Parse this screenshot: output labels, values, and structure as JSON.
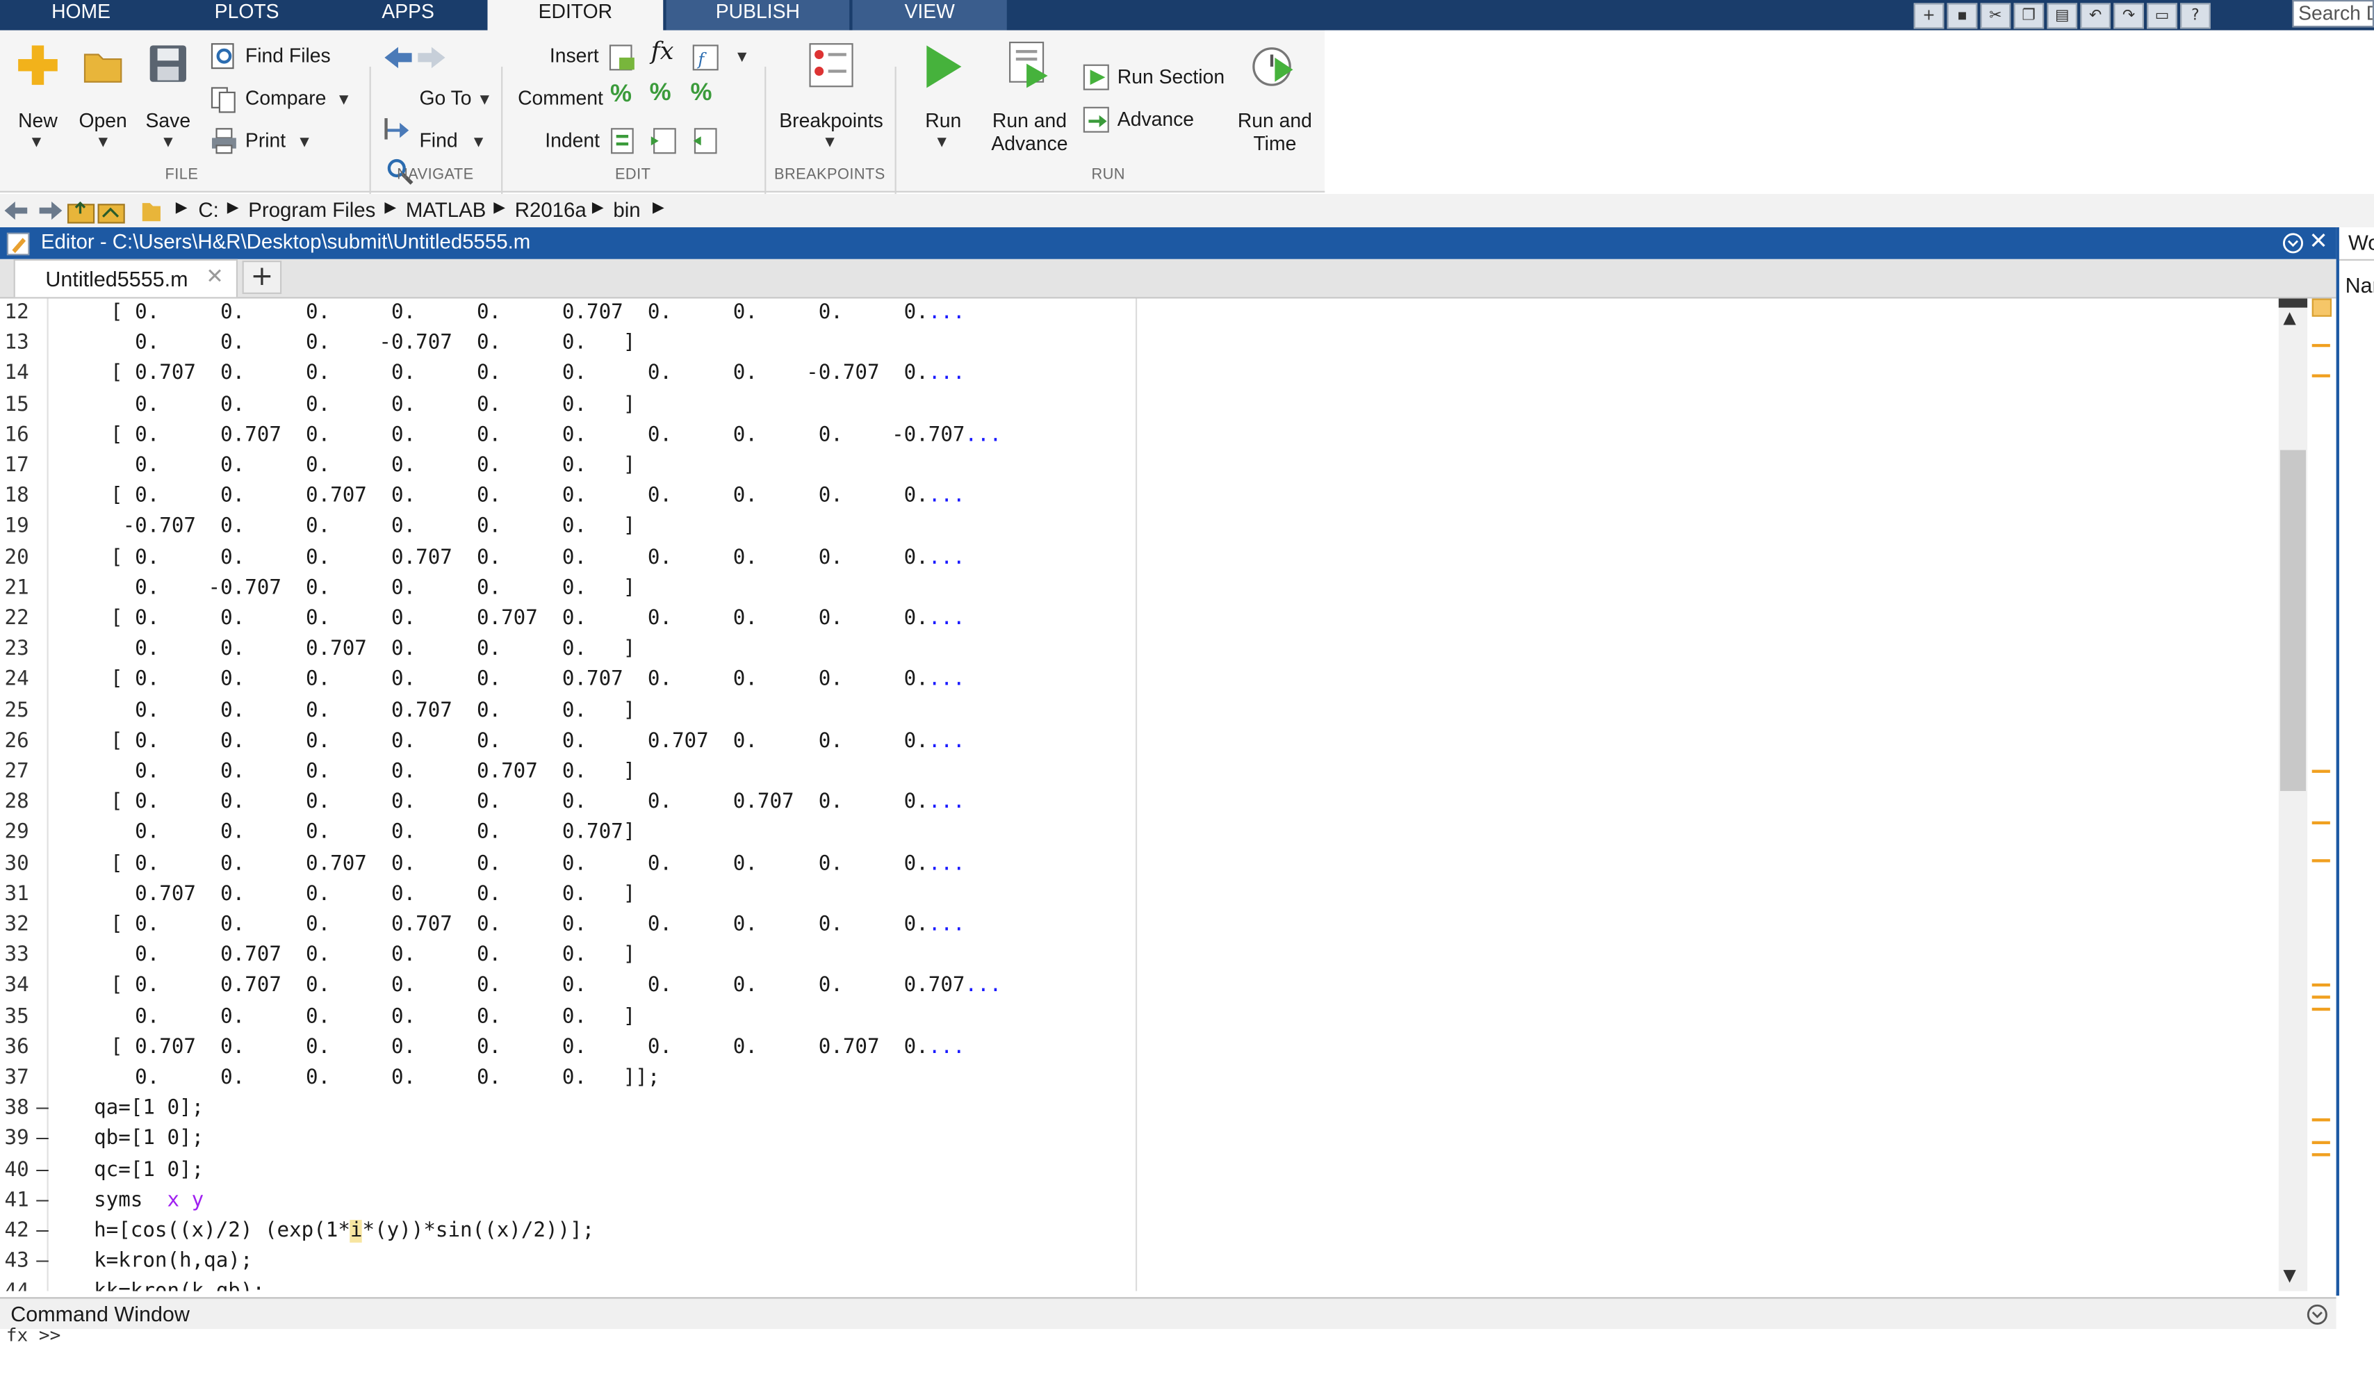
{
  "main_tabs": [
    "HOME",
    "PLOTS",
    "APPS",
    "EDITOR",
    "PUBLISH",
    "VIEW"
  ],
  "search": {
    "placeholder": "Search Documentation",
    "visible": "Search D"
  },
  "ribbon": {
    "file": {
      "label": "FILE",
      "new": "New",
      "open": "Open",
      "save": "Save",
      "find_files": "Find Files",
      "compare": "Compare",
      "print": "Print"
    },
    "navigate": {
      "label": "NAVIGATE",
      "go_to": "Go To",
      "find": "Find"
    },
    "edit": {
      "label": "EDIT",
      "insert": "Insert",
      "comment": "Comment",
      "indent": "Indent",
      "fx": "fx"
    },
    "breakpoints": {
      "label": "BREAKPOINTS",
      "breakpoints": "Breakpoints"
    },
    "run": {
      "label": "RUN",
      "run": "Run",
      "run_and_advance_1": "Run and",
      "run_and_advance_2": "Advance",
      "run_section": "Run Section",
      "advance": "Advance",
      "run_and_time_1": "Run and",
      "run_and_time_2": "Time"
    }
  },
  "path": [
    "C:",
    "Program Files",
    "MATLAB",
    "R2016a",
    "bin"
  ],
  "editor": {
    "title": "Editor - C:\\Users\\H&R\\Desktop\\submit\\Untitled5555.m",
    "tab_name": "Untitled5555.m",
    "tab_close": "✕",
    "new_tab": "+",
    "lines": [
      {
        "n": "12",
        "dash": "",
        "text": "[ 0.     0.     0.     0.     0.     0.707  0.     0.     0.     0.",
        "cont": "...",
        "indent": "row"
      },
      {
        "n": "13",
        "dash": "",
        "text": "  0.     0.     0.    -0.707  0.     0.   ]",
        "cont": "",
        "indent": "row"
      },
      {
        "n": "14",
        "dash": "",
        "text": "[ 0.707  0.     0.     0.     0.     0.     0.     0.    -0.707  0.",
        "cont": "...",
        "indent": "row"
      },
      {
        "n": "15",
        "dash": "",
        "text": "  0.     0.     0.     0.     0.     0.   ]",
        "cont": "",
        "indent": "row"
      },
      {
        "n": "16",
        "dash": "",
        "text": "[ 0.     0.707  0.     0.     0.     0.     0.     0.     0.    -0.707",
        "cont": "...",
        "indent": "row"
      },
      {
        "n": "17",
        "dash": "",
        "text": "  0.     0.     0.     0.     0.     0.   ]",
        "cont": "",
        "indent": "row"
      },
      {
        "n": "18",
        "dash": "",
        "text": "[ 0.     0.     0.707  0.     0.     0.     0.     0.     0.     0.",
        "cont": "...",
        "indent": "row"
      },
      {
        "n": "19",
        "dash": "",
        "text": " -0.707  0.     0.     0.     0.     0.   ]",
        "cont": "",
        "indent": "row"
      },
      {
        "n": "20",
        "dash": "",
        "text": "[ 0.     0.     0.     0.707  0.     0.     0.     0.     0.     0.",
        "cont": "...",
        "indent": "row"
      },
      {
        "n": "21",
        "dash": "",
        "text": "  0.    -0.707  0.     0.     0.     0.   ]",
        "cont": "",
        "indent": "row"
      },
      {
        "n": "22",
        "dash": "",
        "text": "[ 0.     0.     0.     0.     0.707  0.     0.     0.     0.     0.",
        "cont": "...",
        "indent": "row"
      },
      {
        "n": "23",
        "dash": "",
        "text": "  0.     0.     0.707  0.     0.     0.   ]",
        "cont": "",
        "indent": "row"
      },
      {
        "n": "24",
        "dash": "",
        "text": "[ 0.     0.     0.     0.     0.     0.707  0.     0.     0.     0.",
        "cont": "...",
        "indent": "row"
      },
      {
        "n": "25",
        "dash": "",
        "text": "  0.     0.     0.     0.707  0.     0.   ]",
        "cont": "",
        "indent": "row"
      },
      {
        "n": "26",
        "dash": "",
        "text": "[ 0.     0.     0.     0.     0.     0.     0.707  0.     0.     0.",
        "cont": "...",
        "indent": "row"
      },
      {
        "n": "27",
        "dash": "",
        "text": "  0.     0.     0.     0.     0.707  0.   ]",
        "cont": "",
        "indent": "row"
      },
      {
        "n": "28",
        "dash": "",
        "text": "[ 0.     0.     0.     0.     0.     0.     0.     0.707  0.     0.",
        "cont": "...",
        "indent": "row"
      },
      {
        "n": "29",
        "dash": "",
        "text": "  0.     0.     0.     0.     0.     0.707]",
        "cont": "",
        "indent": "row"
      },
      {
        "n": "30",
        "dash": "",
        "text": "[ 0.     0.     0.707  0.     0.     0.     0.     0.     0.     0.",
        "cont": "...",
        "indent": "row"
      },
      {
        "n": "31",
        "dash": "",
        "text": "  0.707  0.     0.     0.     0.     0.   ]",
        "cont": "",
        "indent": "row"
      },
      {
        "n": "32",
        "dash": "",
        "text": "[ 0.     0.     0.     0.707  0.     0.     0.     0.     0.     0.",
        "cont": "...",
        "indent": "row"
      },
      {
        "n": "33",
        "dash": "",
        "text": "  0.     0.707  0.     0.     0.     0.   ]",
        "cont": "",
        "indent": "row"
      },
      {
        "n": "34",
        "dash": "",
        "text": "[ 0.     0.707  0.     0.     0.     0.     0.     0.     0.     0.707",
        "cont": "...",
        "indent": "row"
      },
      {
        "n": "35",
        "dash": "",
        "text": "  0.     0.     0.     0.     0.     0.   ]",
        "cont": "",
        "indent": "row"
      },
      {
        "n": "36",
        "dash": "",
        "text": "[ 0.707  0.     0.     0.     0.     0.     0.     0.     0.707  0.",
        "cont": "...",
        "indent": "row"
      },
      {
        "n": "37",
        "dash": "",
        "text": "  0.     0.     0.     0.     0.     0.   ]];",
        "cont": "",
        "indent": "row"
      },
      {
        "n": "38",
        "dash": "—",
        "text": "qa=[1 0];",
        "cont": "",
        "indent": "top"
      },
      {
        "n": "39",
        "dash": "—",
        "text": "qb=[1 0];",
        "cont": "",
        "indent": "top"
      },
      {
        "n": "40",
        "dash": "—",
        "text": "qc=[1 0];",
        "cont": "",
        "indent": "top"
      },
      {
        "n": "41",
        "dash": "—",
        "text": "",
        "cont": "",
        "indent": "top",
        "syms": true
      },
      {
        "n": "42",
        "dash": "—",
        "text": "",
        "cont": "",
        "indent": "top",
        "hline": true
      },
      {
        "n": "43",
        "dash": "—",
        "text": "k=kron(h,qa);",
        "cont": "",
        "indent": "top"
      },
      {
        "n": "44",
        "dash": "—",
        "text": "kk=kron(k,qb);",
        "cont": "",
        "indent": "top"
      }
    ],
    "syms_line": {
      "kw": "syms",
      "args": "x y"
    },
    "h_line": {
      "before": "h=[cos((x)/2) (exp(1*",
      "hl": "i",
      "after": "*(y))*sin((x)/2))];"
    }
  },
  "command_window": {
    "title": "Command Window",
    "prompt": "fx >>"
  },
  "right_panel": {
    "title_clip": "Wo",
    "name_clip": "Nar"
  },
  "colors": {
    "accent": "#1d59a3",
    "tabbar": "#1a3d6b",
    "continuation": "#1a1aff",
    "syms_args": "#a020f0",
    "marker": "#f0a020"
  }
}
